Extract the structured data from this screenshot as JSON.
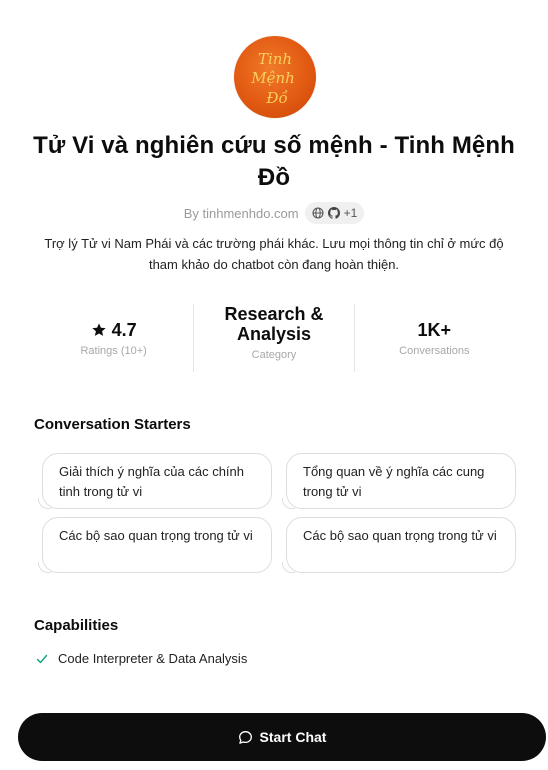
{
  "gpt": {
    "logo_lines": [
      "Tinh",
      "Mệnh",
      "Đồ"
    ],
    "title": "Tử Vi và nghiên cứu số mệnh - Tinh Mệnh Đồ",
    "byline": "By tinhmenhdo.com",
    "chip_more": "+1",
    "description": "Trợ lý Tử vi Nam Phái và các trường phái khác. Lưu mọi thông tin chỉ ở mức độ tham khảo do chatbot còn đang hoàn thiện."
  },
  "stats": {
    "rating_value": "4.7",
    "rating_label": "Ratings (10+)",
    "category_value": "Research & Analysis",
    "category_label": "Category",
    "conversations_value": "1K+",
    "conversations_label": "Conversations"
  },
  "starters": {
    "title": "Conversation Starters",
    "items": [
      "Giải thích ý nghĩa của các chính tinh trong tử vi",
      "Tổng quan về ý nghĩa các cung trong tử vi",
      "Các bộ sao quan trọng trong tử vi",
      "Các bộ sao quan trọng trong tử vi"
    ]
  },
  "capabilities": {
    "title": "Capabilities",
    "items": [
      "Code Interpreter & Data Analysis"
    ]
  },
  "actions": {
    "start_chat": "Start Chat"
  },
  "colors": {
    "logo_orange": "#e25a12",
    "logo_text": "#f6d05a",
    "button_bg": "#0d0d0d",
    "check_green": "#10a37f"
  },
  "icons": [
    "star-icon",
    "globe-icon",
    "github-icon",
    "check-icon",
    "chat-bubble-icon"
  ]
}
